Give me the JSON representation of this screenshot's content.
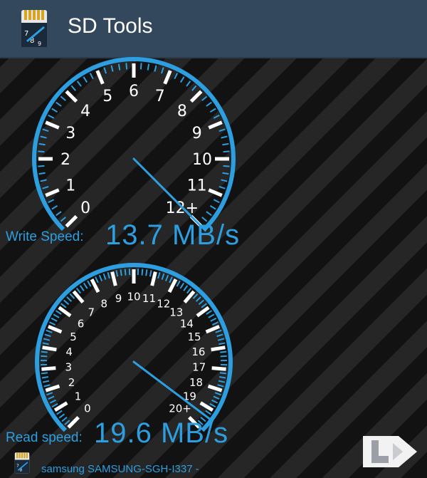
{
  "app": {
    "title": "SD Tools",
    "icon": "sd-card-gauge-icon"
  },
  "write_gauge": {
    "tick_labels": [
      "0",
      "1",
      "2",
      "3",
      "4",
      "5",
      "6",
      "7",
      "8",
      "9",
      "10",
      "11",
      "12+"
    ],
    "needle_value": 12.0,
    "label": "Write Speed:",
    "value": "13.7 MB/s"
  },
  "read_gauge": {
    "tick_labels": [
      "0",
      "1",
      "2",
      "3",
      "4",
      "5",
      "6",
      "7",
      "8",
      "9",
      "10",
      "11",
      "12",
      "13",
      "14",
      "15",
      "16",
      "17",
      "18",
      "19",
      "20+"
    ],
    "needle_value": 19.4,
    "label": "Read speed:",
    "value": "19.6 MB/s"
  },
  "device": {
    "name": "samsung SAMSUNG-SGH-I337 -",
    "icon": "sd-card-gauge-icon"
  },
  "colors": {
    "accent": "#2d9fe0",
    "topbar": "#33485c",
    "tick_white": "#ffffff",
    "needle": "#2d9fe0"
  }
}
